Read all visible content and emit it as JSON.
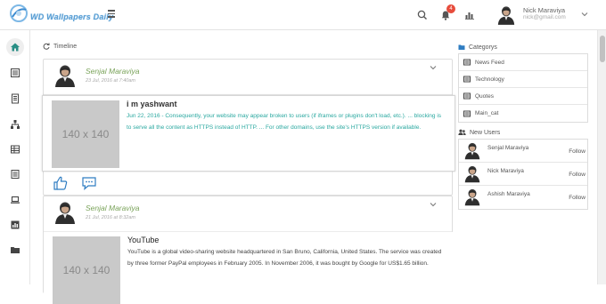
{
  "header": {
    "logo_text": "WD Wallpapers Daily",
    "notification_count": "4",
    "user_name": "Nick Maraviya",
    "user_email": "nick@gmail.com"
  },
  "sidebar": {
    "items": [
      "home-icon",
      "newspaper-icon",
      "document-icon",
      "sitemap-icon",
      "table-icon",
      "list-icon",
      "laptop-icon",
      "chart-icon",
      "folder-icon"
    ]
  },
  "timeline": {
    "label": "Timeline",
    "posts": [
      {
        "author": "Senjal Maraviya",
        "date": "23 Jul, 2016 at 7:40am",
        "thumb_label": "140 x 140",
        "title": "i m yashwant",
        "body": "Jun 22, 2016 - Consequently, your website may appear broken to users (if iframes or plugins don't load, etc.). ... blocking is to serve all the content as HTTPS instead of HTTP. ... For other domains, use the site's HTTPS version if available."
      },
      {
        "author": "Senjal Maraviya",
        "date": "21 Jul, 2016 at 8:32am",
        "thumb_label": "140 x 140",
        "title": "YouTube",
        "body": "YouTube is a global video-sharing website headquartered in San Bruno, California, United States. The service was created by three former PayPal employees in February 2005. In November 2006, it was bought by Google for US$1.65 billion."
      }
    ]
  },
  "categories": {
    "label": "Categorys",
    "items": [
      "News Feed",
      "Technology",
      "Quotes",
      "Main_cat"
    ]
  },
  "new_users": {
    "label": "New Users",
    "follow_label": "Follow",
    "items": [
      "Senjal Maraviya",
      "Nick Maraviya",
      "Ashish Maraviya"
    ]
  },
  "colors": {
    "post_text_teal": "#2aa8a0",
    "post_text_dark": "#444444",
    "author_green": "#7aa35a",
    "badge_red": "#e74c3c",
    "logo_blue": "#5a9fd4"
  }
}
